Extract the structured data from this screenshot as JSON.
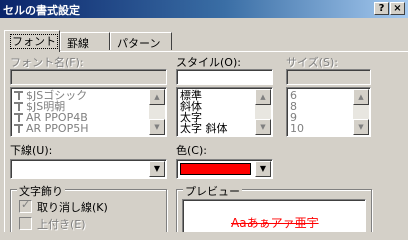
{
  "window": {
    "title": "セルの書式設定",
    "help_btn": "?",
    "close_btn": "×"
  },
  "tabs": [
    "フォント",
    "罫線",
    "パターン"
  ],
  "font": {
    "label": "フォント名(F):",
    "value": "",
    "items": [
      "$JSゴシック",
      "$JS明朝",
      "AR PPOP4B",
      "AR PPOP5H"
    ]
  },
  "style": {
    "label": "スタイル(O):",
    "value": "",
    "items": [
      "標準",
      "斜体",
      "太字",
      "太字 斜体"
    ]
  },
  "size": {
    "label": "サイズ(S):",
    "value": "",
    "items": [
      "6",
      "8",
      "9",
      "10"
    ]
  },
  "underline": {
    "label": "下線(U):",
    "value": ""
  },
  "color": {
    "label": "色(C):",
    "swatch": "#ff0000"
  },
  "effects": {
    "title": "文字飾り",
    "strike": "取り消し線(K)",
    "superscript": "上付き(E)"
  },
  "preview": {
    "title": "プレビュー",
    "sample": "Aaあぁアァ亜宇",
    "sample_color": "#ff0000"
  },
  "colors": {
    "accent_title": "#0a246a"
  }
}
